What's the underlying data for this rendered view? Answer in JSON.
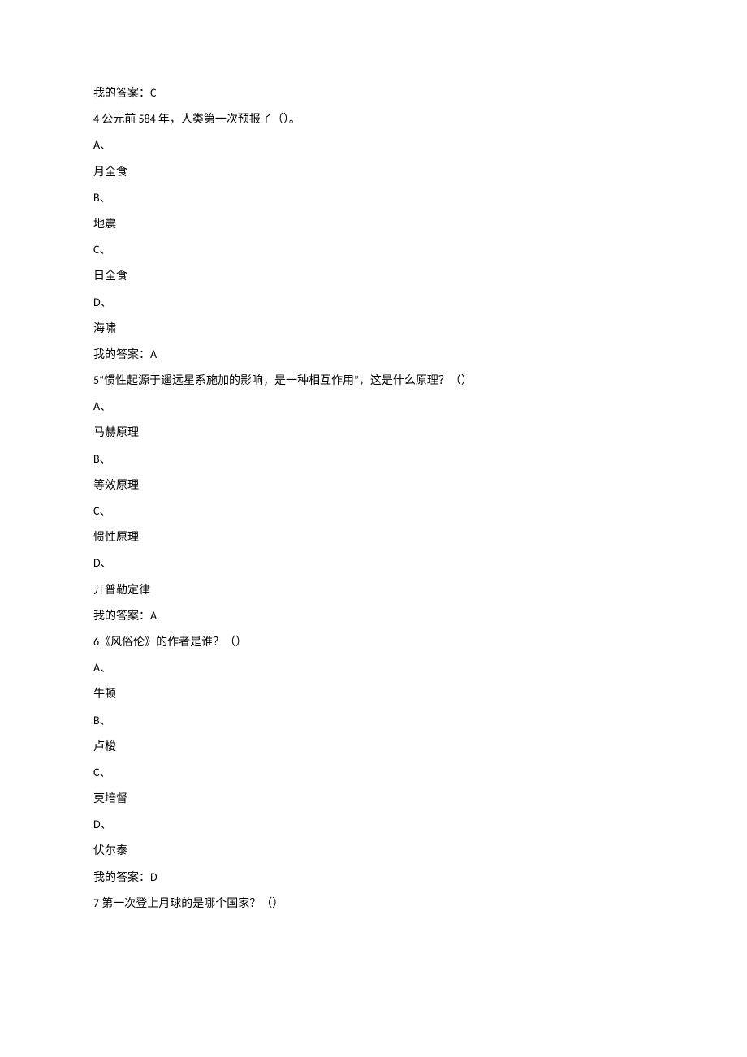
{
  "lines": {
    "l0": "我的答案：C",
    "l1_pre": "4 ",
    "l1_mid": "公元前 ",
    "l1_num": "584 ",
    "l1_post": "年，人类第一次预报了（）。",
    "l2": "A、",
    "l3": "月全食",
    "l4": "B、",
    "l5": "地震",
    "l6": "C、",
    "l7": "日全食",
    "l8": "D、",
    "l9": "海啸",
    "l10": "我的答案：A",
    "l11_pre": "5",
    "l11_post": "“惯性起源于遥远星系施加的影响，是一种相互作用”，这是什么原理？（）",
    "l12": "A、",
    "l13": "马赫原理",
    "l14": "B、",
    "l15": "等效原理",
    "l16": "C、",
    "l17": "惯性原理",
    "l18": "D、",
    "l19": "开普勒定律",
    "l20": "我的答案：A",
    "l21_pre": "6",
    "l21_post": "《风俗伦》的作者是谁？（）",
    "l22": "A、",
    "l23": "牛顿",
    "l24": "B、",
    "l25": "卢梭",
    "l26": "C、",
    "l27": "莫培督",
    "l28": "D、",
    "l29": "伏尔泰",
    "l30": "我的答案：D",
    "l31_pre": "7 ",
    "l31_post": "第一次登上月球的是哪个国家？（）"
  }
}
